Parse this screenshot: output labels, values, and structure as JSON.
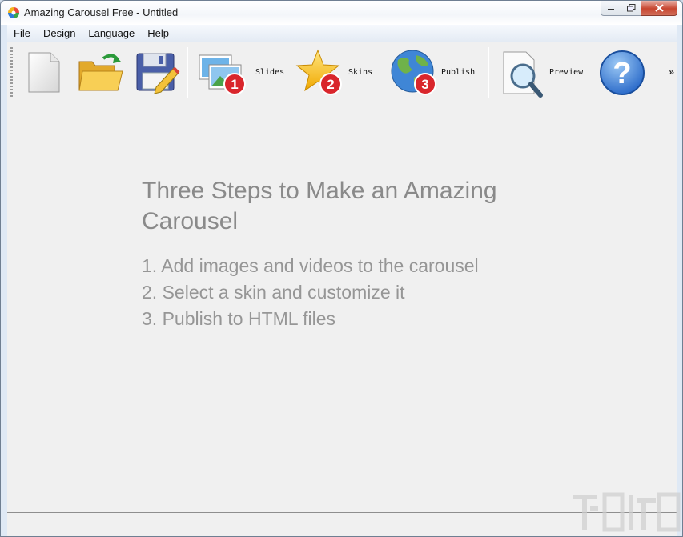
{
  "window": {
    "title": "Amazing Carousel Free - Untitled"
  },
  "menu": {
    "items": [
      "File",
      "Design",
      "Language",
      "Help"
    ]
  },
  "toolbar": {
    "slides_label": "Slides",
    "skins_label": "Skins",
    "publish_label": "Publish",
    "preview_label": "Preview",
    "overflow": "»",
    "badges": [
      "1",
      "2",
      "3"
    ]
  },
  "main": {
    "heading": "Three Steps to Make an Amazing Carousel",
    "steps": [
      "1. Add images and videos to the carousel",
      "2. Select a skin and customize it",
      "3. Publish to HTML files"
    ]
  },
  "colors": {
    "heading": "#8a8a8a",
    "steps": "#969696",
    "badge": "#d9262c",
    "close": "#c7452f"
  }
}
